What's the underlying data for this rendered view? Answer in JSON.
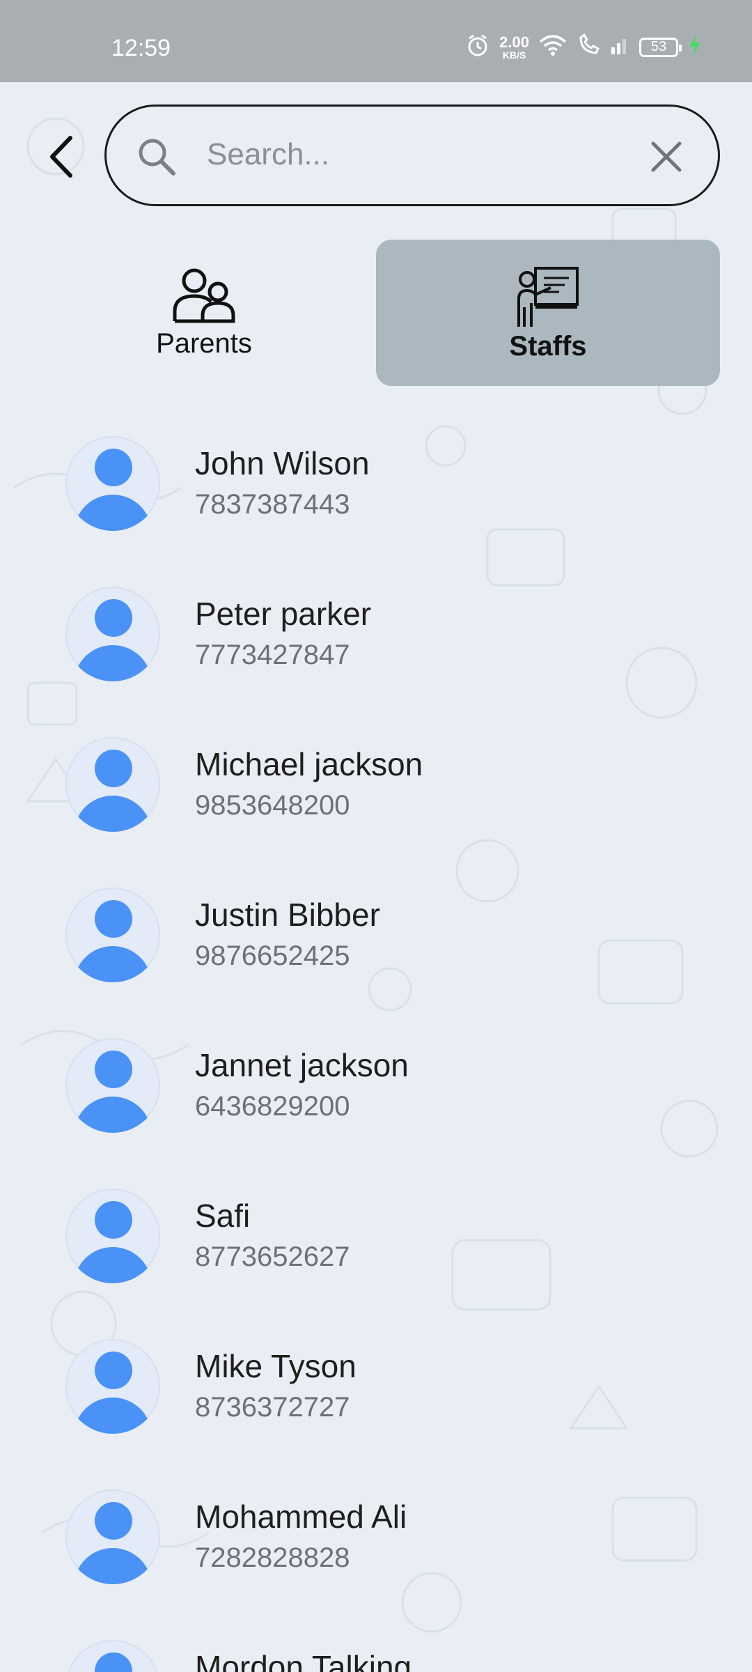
{
  "status_bar": {
    "time": "12:59",
    "net_speed_value": "2.00",
    "net_speed_unit": "KB/S",
    "battery": "53"
  },
  "search": {
    "placeholder": "Search...",
    "value": ""
  },
  "tabs": [
    {
      "label": "Parents",
      "selected": false,
      "icon": "parents-icon"
    },
    {
      "label": "Staffs",
      "selected": true,
      "icon": "teacher-board-icon"
    }
  ],
  "contacts": [
    {
      "name": "John Wilson",
      "phone": "7837387443"
    },
    {
      "name": "Peter parker",
      "phone": "7773427847"
    },
    {
      "name": "Michael jackson",
      "phone": "9853648200"
    },
    {
      "name": "Justin Bibber",
      "phone": "9876652425"
    },
    {
      "name": "Jannet jackson",
      "phone": "6436829200"
    },
    {
      "name": "Safi",
      "phone": "8773652627"
    },
    {
      "name": "Mike Tyson",
      "phone": "8736372727"
    },
    {
      "name": "Mohammed Ali",
      "phone": "7282828828"
    },
    {
      "name": "Mordon Talking",
      "phone": ""
    }
  ],
  "colors": {
    "accent_avatar": "#4a92f5",
    "selected_tab_bg": "#acb8bf",
    "status_bar_bg": "#a9aeb3",
    "charging_bolt": "#4cd964"
  }
}
